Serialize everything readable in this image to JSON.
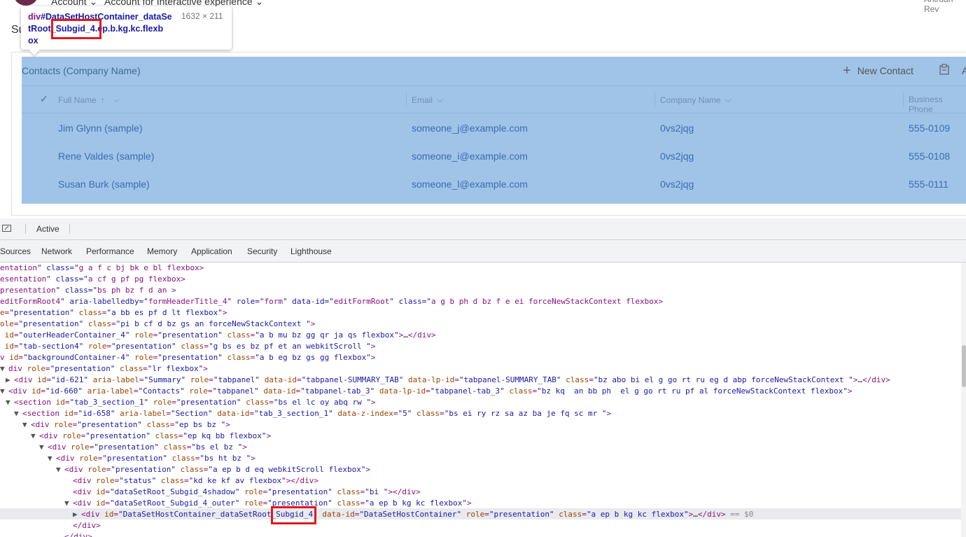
{
  "app": {
    "entity_label": "Account",
    "form_label": "Account for Interactive experience",
    "user_name": "Anirudh Rev",
    "section_title_partial": "Su"
  },
  "subgrid": {
    "title": "Contacts (Company Name)",
    "new_contact_label": "New Contact",
    "columns": [
      {
        "label": "Full Name",
        "sort": "↑",
        "chevron": "⌵"
      },
      {
        "label": "Email",
        "chevron": "⌵"
      },
      {
        "label": "Company Name",
        "chevron": "⌵"
      },
      {
        "label": "Business Phone"
      }
    ],
    "rows": [
      {
        "full_name": "Jim Glynn (sample)",
        "email": "someone_j@example.com",
        "company": "0vs2jqg",
        "phone": "555-0109"
      },
      {
        "full_name": "Rene Valdes (sample)",
        "email": "someone_i@example.com",
        "company": "0vs2jqg",
        "phone": "555-0108"
      },
      {
        "full_name": "Susan Burk (sample)",
        "email": "someone_l@example.com",
        "company": "0vs2jqg",
        "phone": "555-0111"
      }
    ],
    "highlight_color": "#a0c4e8"
  },
  "tooltip": {
    "tag": "div",
    "selector_line1": "#DataSetHostContainer_dataSe",
    "selector_line2": "tRoot_Subgid_4.",
    "selector_line2b": "ep.b.kg.kc.flexb",
    "selector_line3": "ox",
    "size": "1632 × 211"
  },
  "devtools": {
    "status_label": "Active",
    "tabs": [
      "Sources",
      "Network",
      "Performance",
      "Memory",
      "Application",
      "Security",
      "Lighthouse"
    ],
    "selected_suffix": "== $0",
    "code_lines": [
      "entation\" class=\"g a f c bj bk e bl flexbox\">",
      "esentation\" class=\"a cf g pf pg flexbox\">",
      "presentation\" class=\"bs ph bz f d an \">",
      "editFormRoot4\" aria-labelledby=\"formHeaderTitle_4\" role=\"form\" data-id=\"editFormRoot\" class=\"a g b ph d bz f e ei forceNewStackContext flexbox\">",
      "e=\"presentation\" class=\"a bb es pf d lt flexbox\">",
      "ole=\"presentation\" class=\"pi b cf d bz gs an forceNewStackContext \">",
      " id=\"outerHeaderContainer_4\" role=\"presentation\" class=\"a b mu bz gg qr ja qs flexbox\">…</div>",
      " id=\"tab-section4\" role=\"presentation\" class=\"g bs es bz pf et an webkitScroll \">",
      "v id=\"backgroundContainer-4\" role=\"presentation\" class=\"a b eg bz gs gg flexbox\">",
      "div role=\"presentation\" class=\"lr flexbox\">",
      "<div id=\"id-621\" aria-label=\"Summary\" role=\"tabpanel\" data-id=\"tabpanel-SUMMARY_TAB\" data-lp-id=\"tabpanel-SUMMARY_TAB\" class=\"bz abo bi el g go rt ru eg d abp forceNewStackContext \">…</div>",
      "<div id=\"id-660\" aria-label=\"Contacts\" role=\"tabpanel\" data-id=\"tabpanel-tab_3\" data-lp-id=\"tabpanel-tab_3\" class=\"bz kq  an bb ph  el g go rt ru pf al forceNewStackContext flexbox\">",
      "<section id=\"tab_3_section_1\" role=\"presentation\" class=\"bs el lc oy abq rw \">",
      "<section id=\"id-658\" aria-label=\"Section\" data-id=\"tab_3_section_1\" data-z-index=\"5\" class=\"bs ei ry rz sa az ba je fq sc mr \">",
      "<div role=\"presentation\" class=\"ep bs bz \">",
      "<div role=\"presentation\" class=\"ep kq bb flexbox\">",
      "<div role=\"presentation\" class=\"bs el bz \">",
      "<div role=\"presentation\" class=\"bs ht bz \">",
      "<div role=\"presentation\" class=\"a ep b d eq webkitScroll flexbox\">",
      "<div role=\"status\" class=\"kd ke kf av flexbox\"></div>",
      "<div id=\"dataSetRoot_Subgid_4shadow\" role=\"presentation\" class=\"bi \"></div>",
      "<div id=\"dataSetRoot_Subgid_4_outer\" role=\"presentation\" class=\"a ep b kg kc flexbox\">",
      "<div id=\"DataSetHostContainer_dataSetRoot_Subgid_4\" data-id=\"DataSetHostContainer\" role=\"presentation\" class=\"a ep b kg kc flexbox\">…</div>",
      "</div>",
      "</div>"
    ]
  }
}
